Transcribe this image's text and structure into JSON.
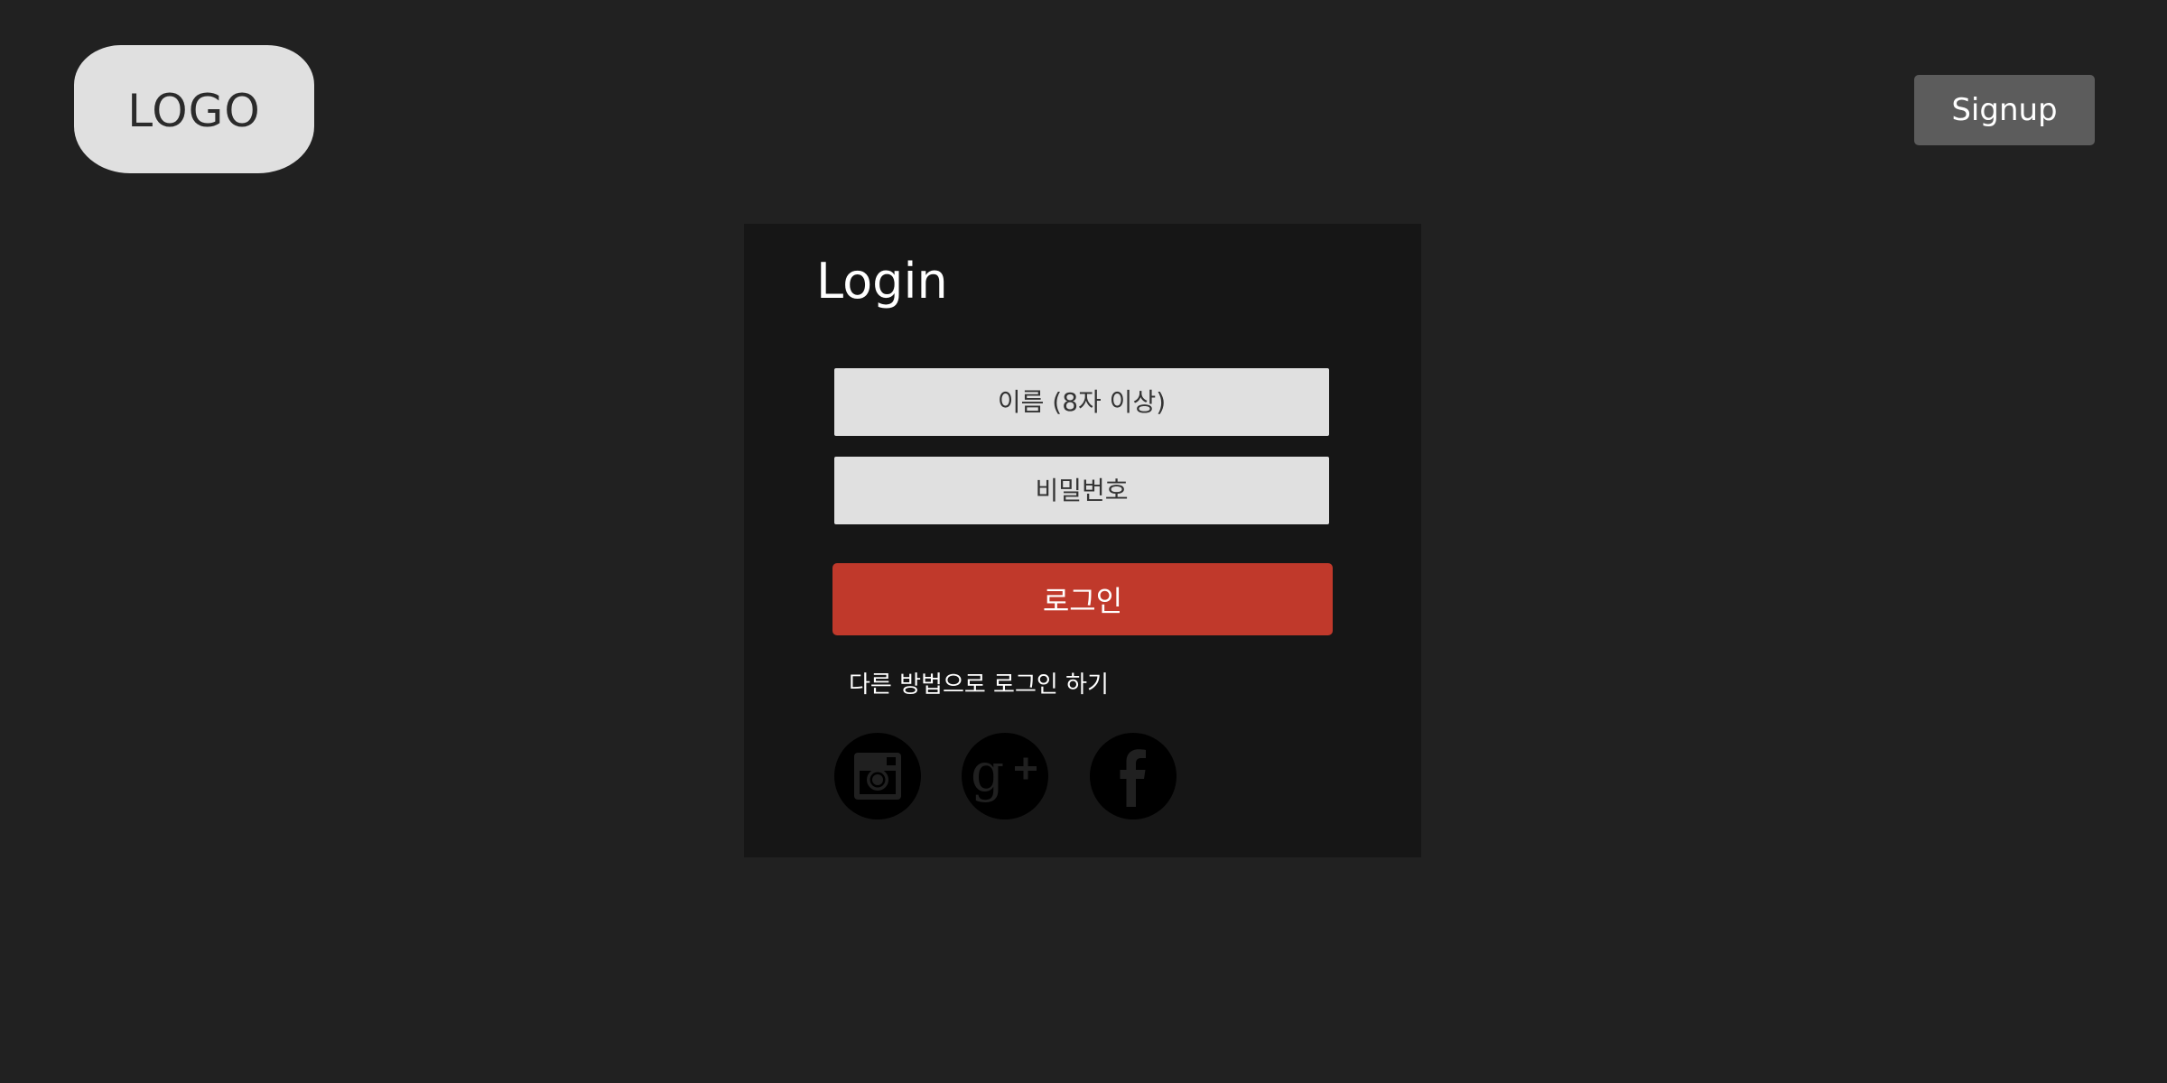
{
  "header": {
    "logo_text": "LOGO",
    "signup_label": "Signup"
  },
  "login": {
    "title": "Login",
    "name_placeholder": "이름 (8자 이상)",
    "password_placeholder": "비밀번호",
    "submit_label": "로그인",
    "alt_login_text": "다른 방법으로 로그인 하기",
    "social_icons": [
      "instagram-icon",
      "google-plus-icon",
      "facebook-icon"
    ]
  },
  "colors": {
    "background": "#212121",
    "panel": "#161616",
    "accent_button": "#c0392b",
    "signup_button": "#5c5c5c",
    "input_fill": "#e0e0e0"
  }
}
